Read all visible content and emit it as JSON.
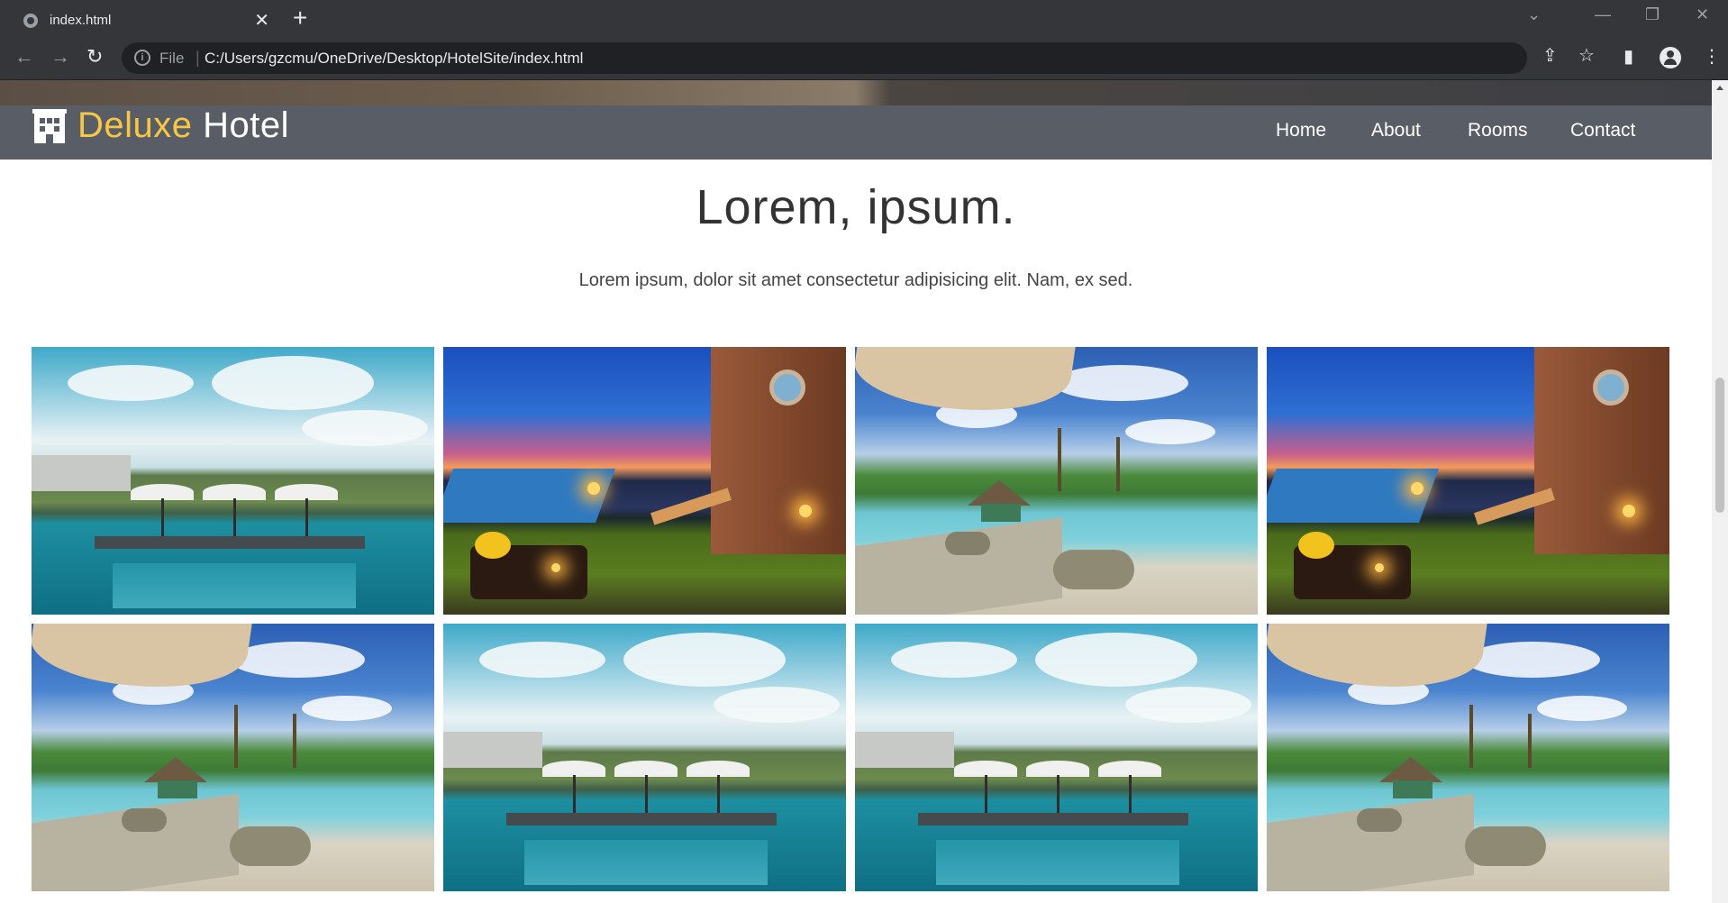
{
  "browser": {
    "tab_title": "index.html",
    "new_tab_label": "+",
    "url_scheme": "File",
    "url": "C:/Users/gzcmu/OneDrive/Desktop/HotelSite/index.html"
  },
  "site": {
    "brand_accent": "Deluxe",
    "brand_rest": "Hotel",
    "brand_accent_color": "#f6c744",
    "nav": {
      "home": "Home",
      "about": "About",
      "rooms": "Rooms",
      "contact": "Contact"
    }
  },
  "section": {
    "heading": "Lorem, ipsum.",
    "subtext": "Lorem ipsum, dolor sit amet consectetur adipisicing elit. Nam, ex sed."
  },
  "gallery": {
    "photos": [
      {
        "scene": "pool-cloudy"
      },
      {
        "scene": "resort-sunset"
      },
      {
        "scene": "tropical-umbrella"
      },
      {
        "scene": "resort-sunset"
      },
      {
        "scene": "tropical-umbrella"
      },
      {
        "scene": "pool-cloudy"
      },
      {
        "scene": "pool-cloudy"
      },
      {
        "scene": "tropical-umbrella"
      }
    ]
  }
}
